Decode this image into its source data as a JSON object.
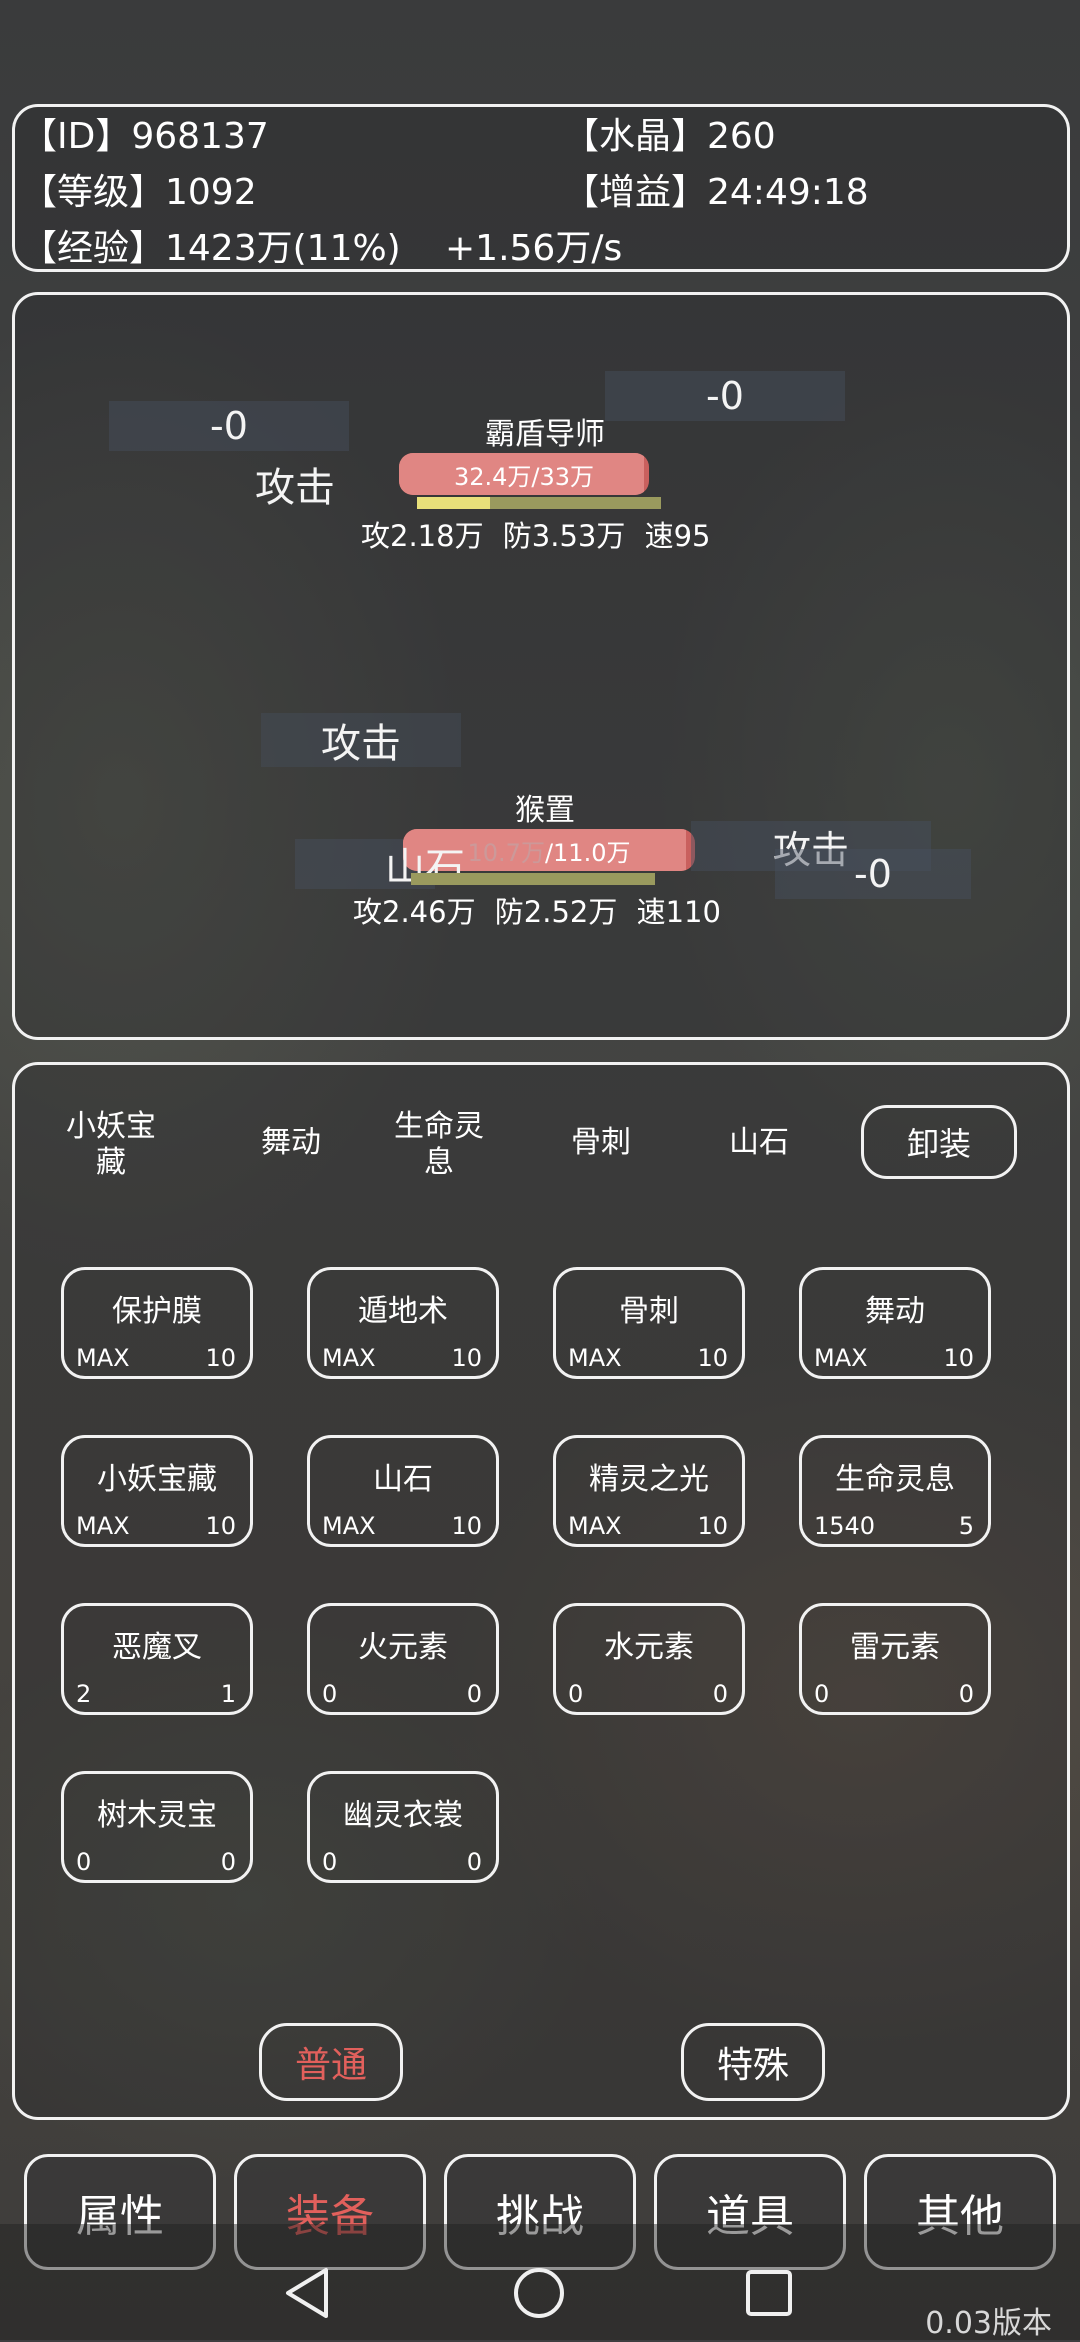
{
  "header": {
    "id_label": "【ID】968137",
    "crystal_label": "【水晶】260",
    "level_label": "【等级】1092",
    "buff_label": "【增益】24:49:18",
    "exp_label": "【经验】1423万(11%)",
    "exp_rate": "+1.56万/s"
  },
  "battle": {
    "enemy": {
      "name": "霸盾导师",
      "hp_text": "32.4万/33万",
      "hp_fraction": 0.98,
      "bar2_fraction": 0.3,
      "attack": "攻2.18万",
      "defense": "防3.53万",
      "speed": "速95",
      "float_dmg_left": "-0",
      "float_dmg_right": "-0",
      "action": "攻击"
    },
    "player": {
      "name": "猴置",
      "hp_text_dim": "10.7万",
      "hp_text": "/11.0万",
      "hp_fraction": 0.97,
      "attack": "攻2.46万",
      "defense": "防2.52万",
      "speed": "速110",
      "action_top": "攻击",
      "action_left": "山石",
      "action_right": "攻击",
      "float_dmg": "-0"
    }
  },
  "equip": {
    "slots": [
      "小妖宝藏",
      "舞动",
      "生命灵息",
      "骨刺",
      "山石"
    ],
    "unequip": "卸装",
    "skills": [
      {
        "name": "保护膜",
        "left": "MAX",
        "right": "10"
      },
      {
        "name": "遁地术",
        "left": "MAX",
        "right": "10"
      },
      {
        "name": "骨刺",
        "left": "MAX",
        "right": "10"
      },
      {
        "name": "舞动",
        "left": "MAX",
        "right": "10"
      },
      {
        "name": "小妖宝藏",
        "left": "MAX",
        "right": "10"
      },
      {
        "name": "山石",
        "left": "MAX",
        "right": "10"
      },
      {
        "name": "精灵之光",
        "left": "MAX",
        "right": "10"
      },
      {
        "name": "生命灵息",
        "left": "1540",
        "right": "5"
      },
      {
        "name": "恶魔叉",
        "left": "2",
        "right": "1"
      },
      {
        "name": "火元素",
        "left": "0",
        "right": "0"
      },
      {
        "name": "水元素",
        "left": "0",
        "right": "0"
      },
      {
        "name": "雷元素",
        "left": "0",
        "right": "0"
      },
      {
        "name": "树木灵宝",
        "left": "0",
        "right": "0"
      },
      {
        "name": "幽灵衣裳",
        "left": "0",
        "right": "0"
      }
    ],
    "mode_normal": "普通",
    "mode_special": "特殊"
  },
  "tabs": [
    "属性",
    "装备",
    "挑战",
    "道具",
    "其他"
  ],
  "active_tab": "装备",
  "version": "0.03版本",
  "colors": {
    "accent_red": "#e2605c",
    "hp_bar": "#c9605e",
    "border": "#f2f2f2"
  },
  "icons": [
    "back-icon",
    "home-icon",
    "recents-icon"
  ]
}
